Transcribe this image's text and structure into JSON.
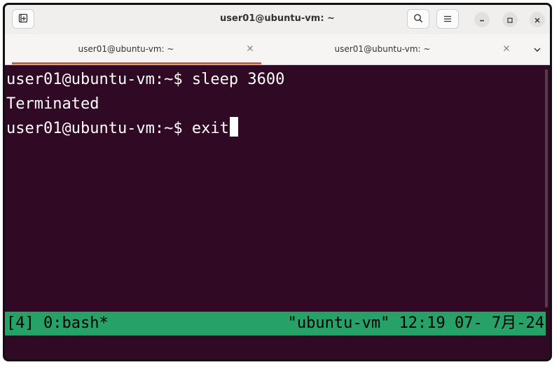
{
  "window": {
    "title": "user01@ubuntu-vm: ~"
  },
  "tabs": [
    {
      "label": "user01@ubuntu-vm: ~",
      "active": true
    },
    {
      "label": "user01@ubuntu-vm: ~",
      "active": false
    }
  ],
  "terminal": {
    "lines": [
      "user01@ubuntu-vm:~$ sleep 3600",
      "Terminated",
      "user01@ubuntu-vm:~$ exit"
    ]
  },
  "tmux": {
    "left": "[4] 0:bash*",
    "right": "\"ubuntu-vm\" 12:19 07- 7月-24"
  },
  "colors": {
    "terminal_bg": "#300a24",
    "tmux_bar": "#26a269",
    "tab_accent": "#e95420"
  },
  "icons": {
    "new_tab": "new-tab-icon",
    "search": "search-icon",
    "menu": "hamburger-menu-icon",
    "minimize": "minimize-icon",
    "maximize": "maximize-icon",
    "close": "close-icon",
    "tab_close": "tab-close-icon",
    "tab_overflow": "chevron-down-icon"
  }
}
